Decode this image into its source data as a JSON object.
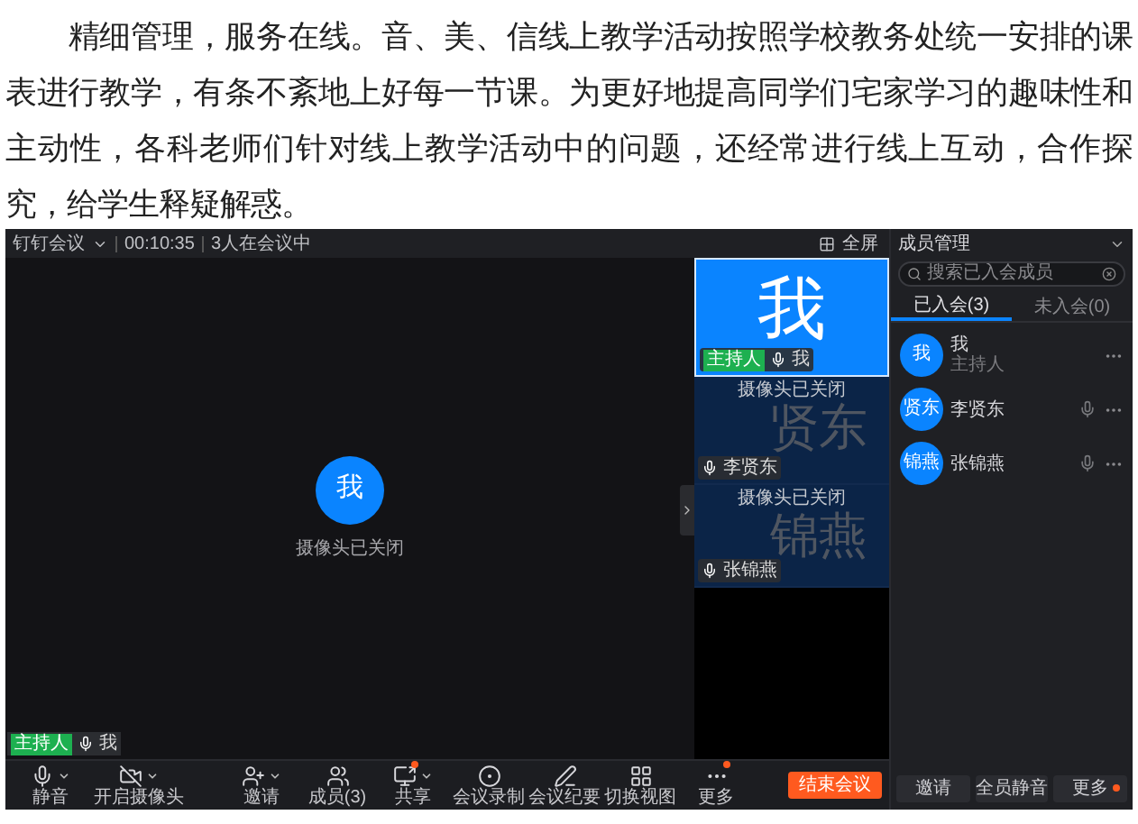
{
  "article": {
    "paragraph": "精细管理，服务在线。音、美、信线上教学活动按照学校教务处统一安排的课表进行教学，有条不紊地上好每一节课。为更好地提高同学们宅家学习的趣味性和主动性，各科老师们针对线上教学活动中的问题，还经常进行线上互动，合作探究，给学生释疑解惑。"
  },
  "meeting": {
    "title": "钉钉会议",
    "timer": "00:10:35",
    "attendance": "3人在会议中",
    "fullscreen": "全屏",
    "main_video": {
      "avatar": "我",
      "status": "摄像头已关闭",
      "badge": "主持人",
      "name": "我"
    },
    "tiles": [
      {
        "watermark": "我",
        "badge": "主持人",
        "name": "我",
        "selected": true
      },
      {
        "watermark": "贤东",
        "status": "摄像头已关闭",
        "name": "李贤东",
        "selected": false
      },
      {
        "watermark": "锦燕",
        "status": "摄像头已关闭",
        "name": "张锦燕",
        "selected": false
      }
    ],
    "toolbar": [
      {
        "label": "静音",
        "dropdown": true,
        "notify": false
      },
      {
        "label": "开启摄像头",
        "dropdown": true,
        "notify": false
      },
      {
        "label": "邀请",
        "dropdown": true,
        "notify": false
      },
      {
        "label": "成员(3)",
        "dropdown": false,
        "notify": false
      },
      {
        "label": "共享",
        "dropdown": true,
        "notify": true
      },
      {
        "label": "会议录制",
        "dropdown": false,
        "notify": false
      },
      {
        "label": "会议纪要",
        "dropdown": false,
        "notify": false
      },
      {
        "label": "切换视图",
        "dropdown": false,
        "notify": false
      },
      {
        "label": "更多",
        "dropdown": false,
        "notify": true
      }
    ],
    "end_button": "结束会议",
    "panel": {
      "title": "成员管理",
      "search": {
        "placeholder": "搜索已入会成员"
      },
      "tabs": [
        {
          "label": "已入会(3)",
          "selected": true
        },
        {
          "label": "未入会(0)",
          "selected": false
        }
      ],
      "members": [
        {
          "avatar": "我",
          "name": "我",
          "role": "主持人",
          "mic": false
        },
        {
          "avatar": "贤东",
          "name": "李贤东",
          "mic": true
        },
        {
          "avatar": "锦燕",
          "name": "张锦燕",
          "mic": true
        }
      ],
      "buttons": [
        {
          "label": "邀请",
          "notify": false
        },
        {
          "label": "全员静音",
          "notify": false
        },
        {
          "label": "更多",
          "notify": true
        }
      ]
    }
  }
}
